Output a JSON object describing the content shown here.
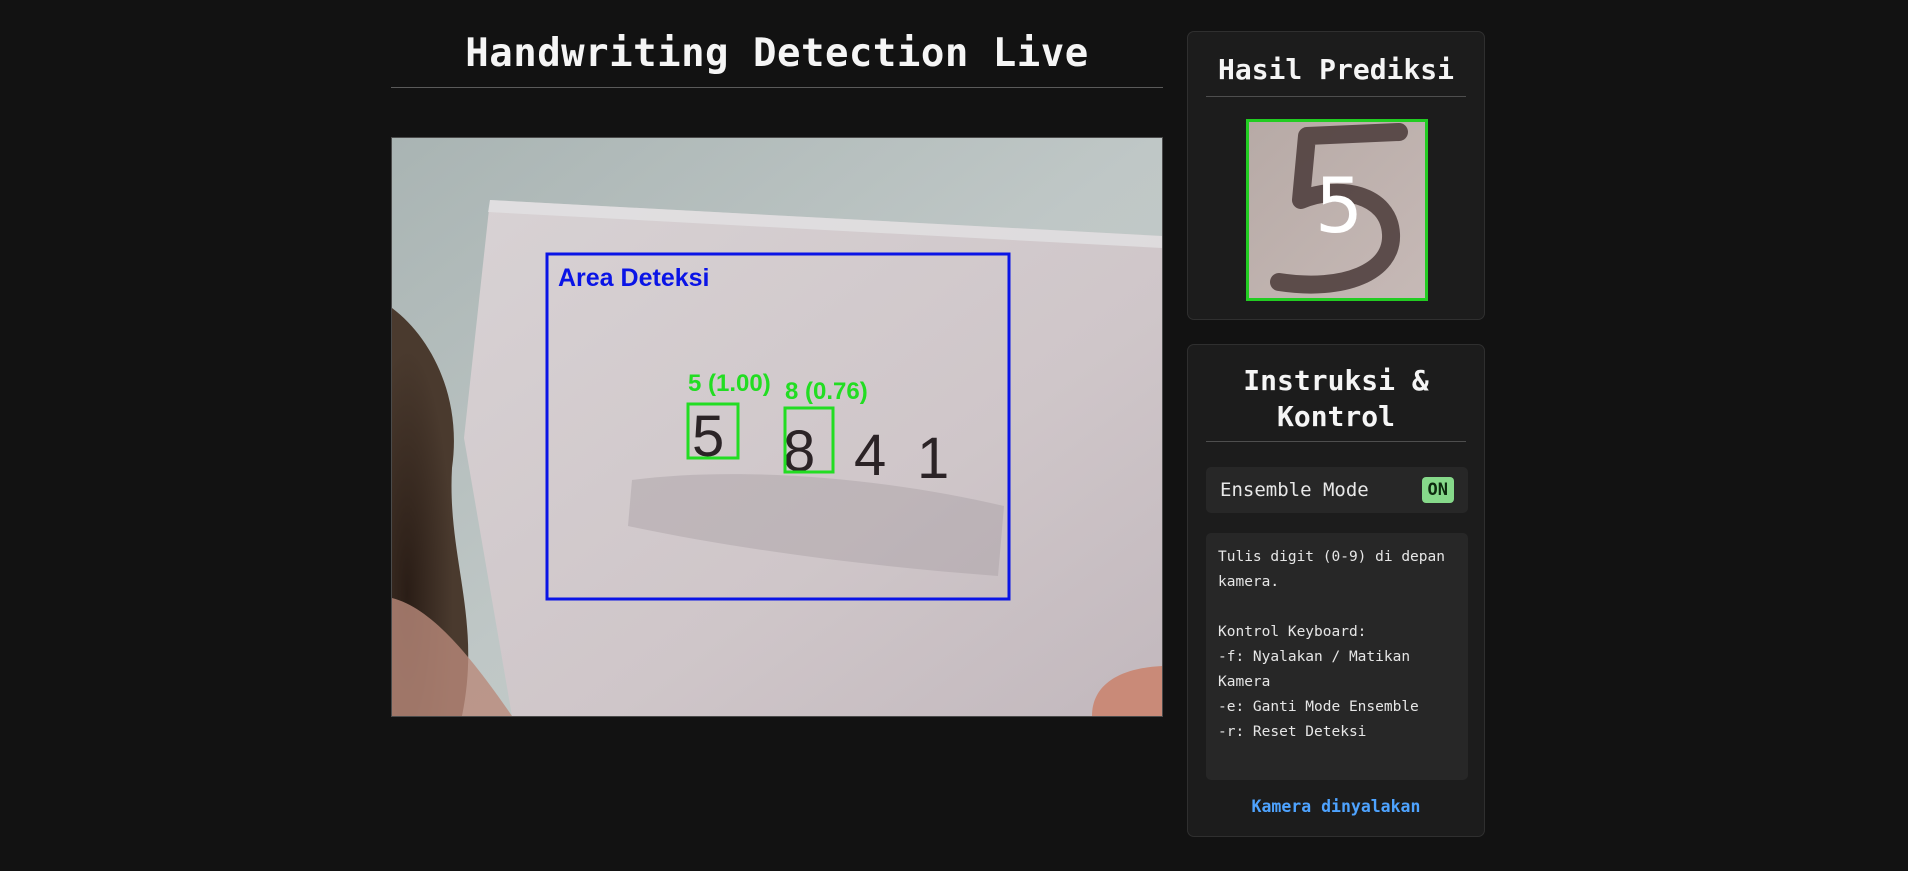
{
  "header": {
    "title": "Handwriting Detection Live"
  },
  "video": {
    "area_label": "Area Deteksi",
    "handwritten_digits": [
      "5",
      "8",
      "4",
      "1"
    ],
    "detections": [
      {
        "label": "5 (1.00)",
        "digit": "5",
        "confidence": 1.0
      },
      {
        "label": "8 (0.76)",
        "digit": "8",
        "confidence": 0.76
      }
    ],
    "colors": {
      "area_box": "#0a14e6",
      "detection_box": "#22dd22"
    }
  },
  "result_panel": {
    "title": "Hasil Prediksi",
    "predicted_digit": "5",
    "frame_color": "#22cc22"
  },
  "instructions_panel": {
    "title_line1": "Instruksi &",
    "title_line2": "Kontrol",
    "ensemble": {
      "label": "Ensemble Mode",
      "state": "ON"
    },
    "instructions": {
      "line1": "Tulis digit (0-9) di depan kamera.",
      "keyboard_heading": "Kontrol Keyboard:",
      "key_f": "-f: Nyalakan / Matikan Kamera",
      "key_e": "-e: Ganti Mode Ensemble",
      "key_r": "-r: Reset Deteksi"
    },
    "status": "Kamera dinyalakan",
    "status_color": "#4ea3ff"
  }
}
